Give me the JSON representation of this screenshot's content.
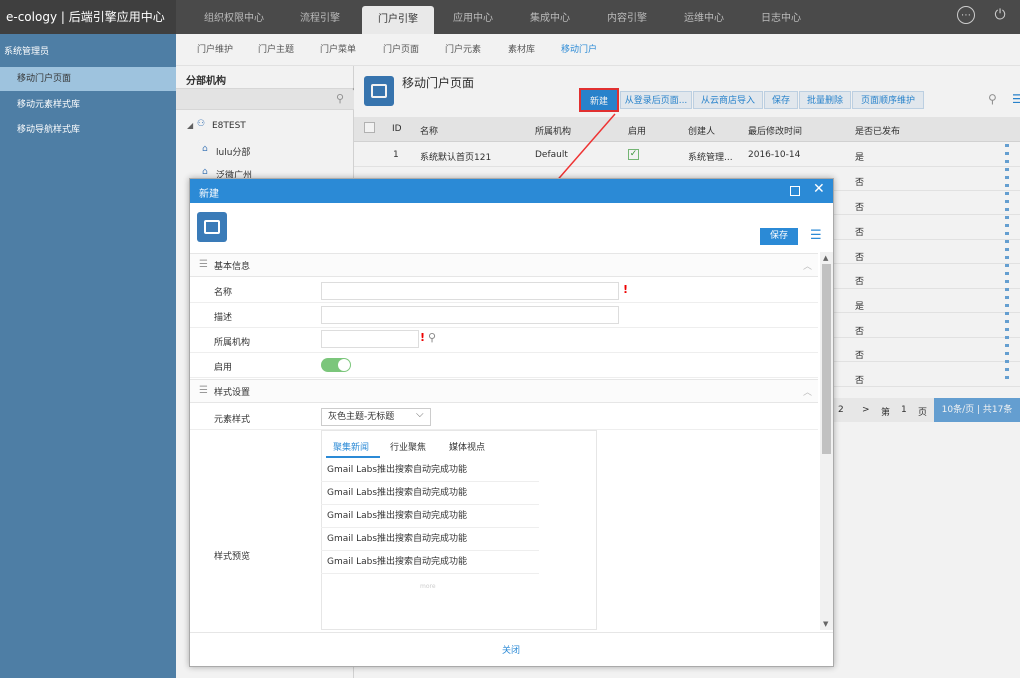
{
  "app": {
    "title": "e-cology | 后端引擎应用中心"
  },
  "topnav": [
    "组织权限中心",
    "流程引擎",
    "门户引擎",
    "应用中心",
    "集成中心",
    "内容引擎",
    "运维中心",
    "日志中心"
  ],
  "sidebar": {
    "title": "系统管理员",
    "items": [
      "移动门户页面",
      "移动元素样式库",
      "移动导航样式库"
    ]
  },
  "subnav": [
    "门户维护",
    "门户主题",
    "门户菜单",
    "门户页面",
    "门户元素",
    "素材库",
    "移动门户"
  ],
  "tree": {
    "title": "分部机构",
    "root": "E8TEST",
    "children": [
      "lulu分部",
      "泛微广州"
    ]
  },
  "page": {
    "title": "移动门户页面"
  },
  "toolbar": [
    "新建",
    "从登录后页面...",
    "从云商店导入",
    "保存",
    "批量删除",
    "页面顺序维护"
  ],
  "grid": {
    "headers": [
      "ID",
      "名称",
      "所属机构",
      "启用",
      "创建人",
      "最后修改时间",
      "是否已发布"
    ],
    "rows": [
      {
        "id": "1",
        "name": "系统默认首页121",
        "org": "Default",
        "creator": "系统管理...",
        "date": "2016-10-14",
        "published": "是"
      }
    ],
    "published_col": [
      "否",
      "否",
      "否",
      "否",
      "否",
      "是",
      "否",
      "否",
      "否"
    ]
  },
  "pager": {
    "page_num": "2",
    "next": ">",
    "go_label": "第",
    "page": "1",
    "page_unit": "页",
    "per_page": "10条/页 | 共17条"
  },
  "dialog": {
    "title": "新建",
    "save": "保存",
    "sections": [
      "基本信息",
      "样式设置"
    ],
    "fields": {
      "name": "名称",
      "desc": "描述",
      "org": "所属机构",
      "enable": "启用",
      "elem_style": "元素样式",
      "preview": "样式预览"
    },
    "style_value": "灰色主题-无标题",
    "preview_tabs": [
      "聚集新闻",
      "行业聚焦",
      "媒体视点"
    ],
    "preview_items": [
      "Gmail Labs推出搜索自动完成功能",
      "Gmail Labs推出搜索自动完成功能",
      "Gmail Labs推出搜索自动完成功能",
      "Gmail Labs推出搜索自动完成功能",
      "Gmail Labs推出搜索自动完成功能"
    ],
    "preview_more": "more",
    "close": "关闭"
  },
  "colors": {
    "accent": "#2b8ad6",
    "sidebar": "#4e7ea5",
    "topbar": "#4a4a4a",
    "required": "#e00"
  }
}
